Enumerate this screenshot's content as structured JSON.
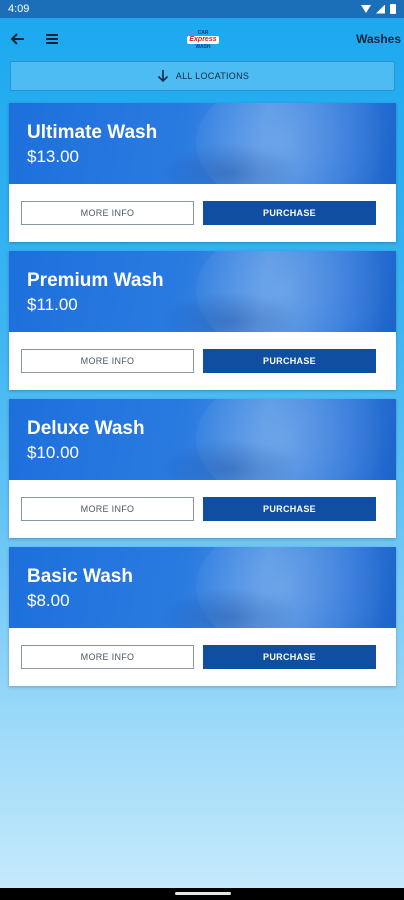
{
  "status_bar": {
    "time": "4:09"
  },
  "app_bar": {
    "title": "Washes",
    "logo": {
      "line1": "CAR",
      "line2": "Express",
      "line3": "WASH"
    }
  },
  "location": {
    "label": "ALL LOCATIONS"
  },
  "buttons": {
    "more_info": "MORE INFO",
    "purchase": "PURCHASE"
  },
  "washes": [
    {
      "name": "Ultimate Wash",
      "price": "$13.00"
    },
    {
      "name": "Premium Wash",
      "price": "$11.00"
    },
    {
      "name": "Deluxe Wash",
      "price": "$10.00"
    },
    {
      "name": "Basic Wash",
      "price": "$8.00"
    }
  ],
  "colors": {
    "accent": "#0f4ea0",
    "status_bar": "#1a6fb8",
    "hero": "#2a7be0",
    "background_top": "#1aa8f0"
  }
}
